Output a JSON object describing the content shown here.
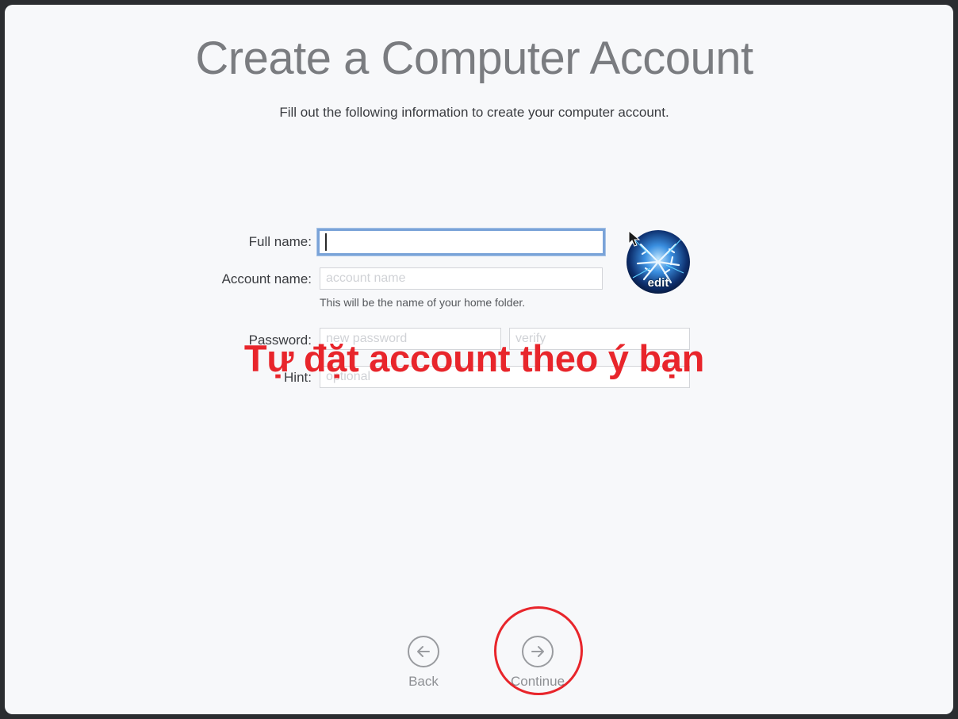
{
  "header": {
    "title": "Create a Computer Account",
    "subtitle": "Fill out the following information to create your computer account."
  },
  "form": {
    "full_name": {
      "label": "Full name:",
      "value": "",
      "placeholder": ""
    },
    "account_name": {
      "label": "Account name:",
      "value": "",
      "placeholder": "account name",
      "helper": "This will be the name of your home folder."
    },
    "password": {
      "label": "Password:",
      "placeholder": "new password",
      "verify_placeholder": "verify"
    },
    "hint": {
      "label": "Hint:",
      "placeholder": "optional"
    }
  },
  "avatar": {
    "edit_label": "edit"
  },
  "annotation": {
    "text": "Tự đặt account theo ý bạn",
    "color": "#e8252b"
  },
  "navigation": {
    "back_label": "Back",
    "continue_label": "Continue"
  },
  "colors": {
    "background": "#f7f8fa",
    "focus_ring": "#7aa3d8",
    "annotation_red": "#e8252b"
  }
}
